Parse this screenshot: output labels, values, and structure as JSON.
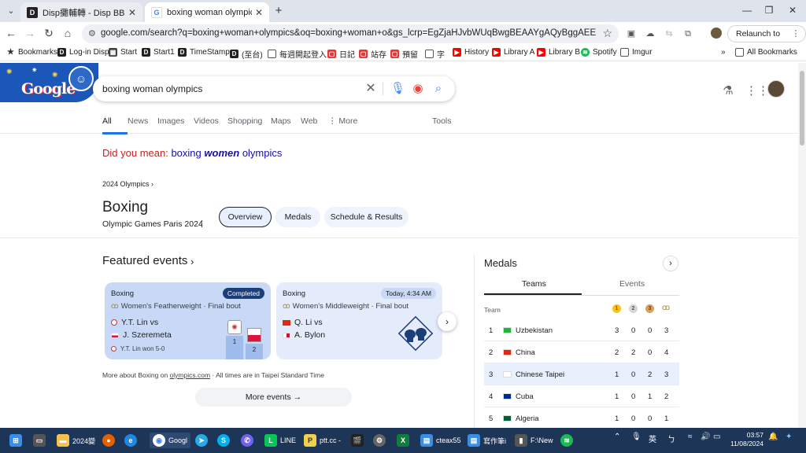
{
  "browser": {
    "tabs": [
      {
        "title": "Disp攤輔轉 - Disp BBS",
        "active": false
      },
      {
        "title": "boxing woman olympics - Goo",
        "active": true
      }
    ],
    "url": "google.com/search?q=boxing+woman+olympics&oq=boxing+woman+o&gs_lcrp=EgZjaHJvbWUqBwgBEAAYgAQyBggAEEUYOTIHCAEQABiABDIJCAI...",
    "relaunch_label": "Relaunch to update",
    "bookmarks": [
      {
        "label": "Bookmarks",
        "icon": "star-icon"
      },
      {
        "label": "Log-in Disp",
        "icon": "disp-icon"
      },
      {
        "label": "Start",
        "icon": "start-icon"
      },
      {
        "label": "Start1",
        "icon": "disp-icon"
      },
      {
        "label": "TimeStamp",
        "icon": "disp-icon"
      },
      {
        "label": "(至台)",
        "icon": "disp-icon"
      },
      {
        "label": "每週開起登入",
        "icon": "folder-icon"
      },
      {
        "label": "日記",
        "icon": "red-icon"
      },
      {
        "label": "站存",
        "icon": "red-icon"
      },
      {
        "label": "預留",
        "icon": "red-icon"
      },
      {
        "label": "字",
        "icon": "folder-icon"
      },
      {
        "label": "History",
        "icon": "youtube-icon"
      },
      {
        "label": "Library A",
        "icon": "youtube-icon"
      },
      {
        "label": "Library B",
        "icon": "youtube-icon"
      },
      {
        "label": "Spotify",
        "icon": "spotify-icon"
      },
      {
        "label": "Imgur",
        "icon": "folder-icon"
      }
    ],
    "all_bookmarks_label": "All Bookmarks"
  },
  "search": {
    "query": "boxing woman olympics",
    "logo_text": "Google",
    "nav_tabs": [
      "All",
      "News",
      "Images",
      "Videos",
      "Shopping",
      "Maps",
      "Web",
      "More"
    ],
    "tools_label": "Tools",
    "did_you_mean_prefix": "Did you mean:",
    "did_you_mean_word1": "boxing",
    "did_you_mean_bold": "women",
    "did_you_mean_word3": "olympics"
  },
  "sport": {
    "breadcrumb": "2024 Olympics",
    "title": "Boxing",
    "subtitle": "Olympic Games Paris 2024",
    "chips": [
      "Overview",
      "Medals",
      "Schedule & Results"
    ],
    "featured_title": "Featured events",
    "events": [
      {
        "sport": "Boxing",
        "badge": "Completed",
        "event": "Women's Featherweight · Final bout",
        "p1": "Y.T. Lin vs",
        "p2": "J. Szeremeta",
        "result": "Y.T. Lin won 5-0",
        "podium1": "1",
        "podium2": "2"
      },
      {
        "sport": "Boxing",
        "badge": "Today, 4:34 AM",
        "event": "Women's Middleweight · Final bout",
        "p1": "Q. Li vs",
        "p2": "A. Bylon"
      }
    ],
    "more_about_prefix": "More about Boxing on",
    "more_about_link": "olympics.com",
    "more_about_suffix": "· All times are in Taipei Standard Time",
    "more_events_label": "More events"
  },
  "medals": {
    "title": "Medals",
    "tabs": [
      "Teams",
      "Events"
    ],
    "header_team": "Team",
    "header_icons": [
      "1",
      "2",
      "3"
    ],
    "rows": [
      {
        "rank": "1",
        "country": "Uzbekistan",
        "gold": "3",
        "silver": "0",
        "bronze": "0",
        "total": "3",
        "flag": "#1eb53a"
      },
      {
        "rank": "2",
        "country": "China",
        "gold": "2",
        "silver": "2",
        "bronze": "0",
        "total": "4",
        "flag": "#de2910"
      },
      {
        "rank": "3",
        "country": "Chinese Taipei",
        "gold": "1",
        "silver": "0",
        "bronze": "2",
        "total": "3",
        "flag": "#ffffff"
      },
      {
        "rank": "4",
        "country": "Cuba",
        "gold": "1",
        "silver": "0",
        "bronze": "1",
        "total": "2",
        "flag": "#002a8f"
      },
      {
        "rank": "5",
        "country": "Algeria",
        "gold": "1",
        "silver": "0",
        "bronze": "0",
        "total": "1",
        "flag": "#006233"
      }
    ]
  },
  "taskbar": {
    "items": [
      "2024變",
      "Googl",
      "LINE",
      "ptt.cc -",
      "cteax55",
      "寫作筆i",
      "F:\\New"
    ],
    "lang": "英",
    "time": "03:57",
    "date": "11/08/2024"
  },
  "colors": {
    "accent": "#1a73e8",
    "link": "#1a0dab",
    "spell_red": "#c5221f",
    "card_completed": "#c8d9f7",
    "card_upcoming": "#e4ecfb",
    "taskbar": "#1d3557"
  }
}
